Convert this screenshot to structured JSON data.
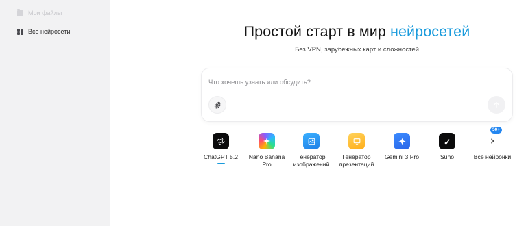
{
  "sidebar": {
    "items": [
      {
        "label": "Мои файлы",
        "icon": "folder-icon",
        "state": "faded"
      },
      {
        "label": "Все нейросети",
        "icon": "grid-icon",
        "state": "active"
      }
    ]
  },
  "hero": {
    "title_main": "Простой старт в мир ",
    "title_accent": "нейросетей",
    "subtitle": "Без VPN, зарубежных карт и сложностей",
    "accent_color": "#1a9bdc"
  },
  "prompt": {
    "placeholder": "Что хочешь узнать или обсудить?",
    "value": ""
  },
  "models": [
    {
      "label": "ChatGPT 5.2",
      "icon": "openai-icon",
      "selected": true
    },
    {
      "label": "Nano Banana\nPro",
      "icon": "sparkle-icon"
    },
    {
      "label": "Генератор\nизображений",
      "icon": "image-icon"
    },
    {
      "label": "Генератор\nпрезентаций",
      "icon": "presentation-icon"
    },
    {
      "label": "Gemini 3 Pro",
      "icon": "gemini-star-icon"
    },
    {
      "label": "Suno",
      "icon": "music-note-icon"
    },
    {
      "label": "Все нейронки",
      "icon": "chevron-right-icon",
      "badge": "50+"
    }
  ]
}
